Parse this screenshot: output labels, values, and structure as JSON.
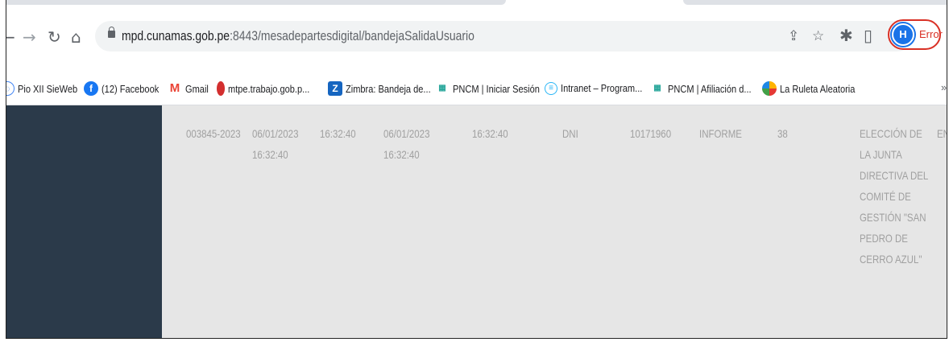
{
  "browser": {
    "url_host": "mpd.cunamas.gob.pe",
    "url_path": ":8443/mesadepartesdigital/bandejaSalidaUsuario",
    "profile_initial": "H",
    "profile_status": "Error",
    "icons": [
      "back-icon",
      "forward-icon",
      "reload-icon",
      "home-icon",
      "lock-icon",
      "share-icon",
      "star-icon",
      "extensions-icon",
      "sidepanel-icon",
      "menu-icon"
    ]
  },
  "bookmarks": [
    {
      "label": "Pio XII SieWeb",
      "icon": "globe",
      "color": "#4285f4"
    },
    {
      "label": "(12) Facebook",
      "icon": "f",
      "color": "#1877f2"
    },
    {
      "label": "Gmail",
      "icon": "M",
      "color": "#ea4335"
    },
    {
      "label": "mtpe.trabajo.gob.p...",
      "icon": "mtpe",
      "color": "#d32f2f"
    },
    {
      "label": "Zimbra: Bandeja de...",
      "icon": "Z",
      "color": "#1565c0"
    },
    {
      "label": "PNCM | Iniciar Sesión",
      "icon": "pncm",
      "color": "#26a69a"
    },
    {
      "label": "Intranet – Program...",
      "icon": "intranet",
      "color": "#29b6f6"
    },
    {
      "label": "PNCM | Afiliación d...",
      "icon": "pncm",
      "color": "#26a69a"
    },
    {
      "label": "La Ruleta Aleatoria",
      "icon": "ruleta",
      "color": "#ffb300"
    }
  ],
  "bookmarks_overflow": "»",
  "row": {
    "numero": "003845-2023",
    "fecha1": "06/01/2023",
    "hora1a": "16:32:40",
    "hora1b": "16:32:40",
    "fecha2": "06/01/2023",
    "hora2a": "16:32:40",
    "hora2b": "16:32:40",
    "tipo_doc": "DNI",
    "num_doc": "10171960",
    "tipo": "INFORME",
    "numero_doc": "38",
    "asunto": "ELECCIÓN DE LA JUNTA DIRECTIVA DEL COMITÉ DE GESTIÓN \"SAN PEDRO DE CERRO AZUL\"",
    "extra": "EN"
  }
}
